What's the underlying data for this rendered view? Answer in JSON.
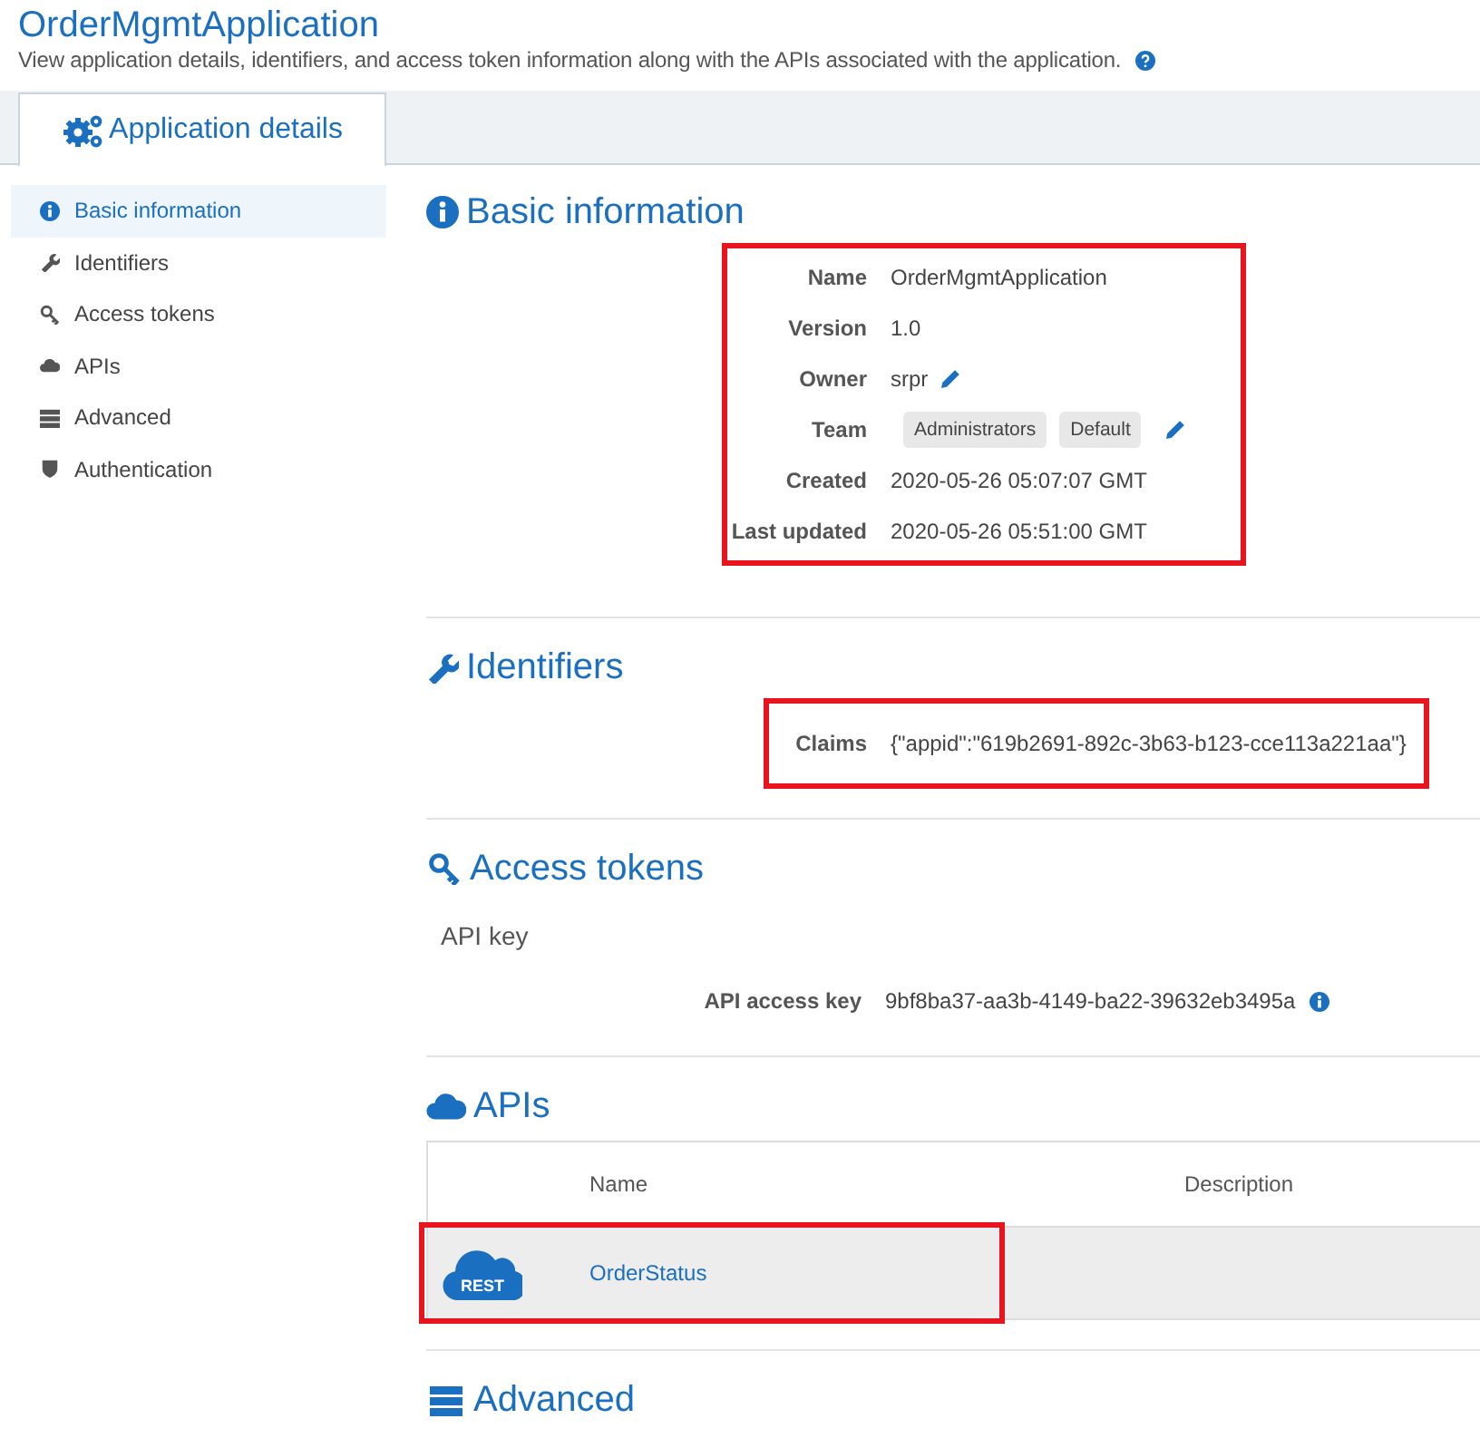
{
  "header": {
    "title": "OrderMgmtApplication",
    "description": "View application details, identifiers, and access token information along with the APIs associated with the application."
  },
  "tabs": [
    {
      "label": "Application details",
      "selected": true
    }
  ],
  "sidebar": {
    "items": [
      {
        "label": "Basic information",
        "kind": "info",
        "selected": true
      },
      {
        "label": "Identifiers",
        "kind": "wrench",
        "selected": false
      },
      {
        "label": "Access tokens",
        "kind": "key",
        "selected": false
      },
      {
        "label": "APIs",
        "kind": "cloud",
        "selected": false
      },
      {
        "label": "Advanced",
        "kind": "server",
        "selected": false
      },
      {
        "label": "Authentication",
        "kind": "shield",
        "selected": false
      }
    ]
  },
  "basic_information": {
    "heading": "Basic information",
    "highlighted": true,
    "fields": [
      {
        "label": "Name",
        "kind": "text",
        "value": "OrderMgmtApplication"
      },
      {
        "label": "Version",
        "kind": "text",
        "value": "1.0"
      },
      {
        "label": "Owner",
        "kind": "editable",
        "value": "srpr"
      },
      {
        "label": "Team",
        "kind": "tags",
        "tags": [
          "Administrators",
          "Default"
        ]
      },
      {
        "label": "Created",
        "kind": "text",
        "value": "2020-05-26 05:07:07 GMT"
      },
      {
        "label": "Last updated",
        "kind": "text",
        "value": "2020-05-26 05:51:00 GMT"
      }
    ]
  },
  "identifiers": {
    "heading": "Identifiers",
    "highlighted": true,
    "label": "Claims",
    "value": "{\"appid\":\"619b2691-892c-3b63-b123-cce113a221aa\"}"
  },
  "access_tokens": {
    "heading": "Access tokens",
    "subheading": "API key",
    "label": "API access key",
    "value": "9bf8ba37-aa3b-4149-ba22-39632eb3495a"
  },
  "apis": {
    "heading": "APIs",
    "columns": [
      "Name",
      "Description"
    ],
    "rows": [
      {
        "type_label": "REST",
        "name": "OrderStatus",
        "highlighted": true
      }
    ]
  },
  "advanced": {
    "heading": "Advanced"
  }
}
